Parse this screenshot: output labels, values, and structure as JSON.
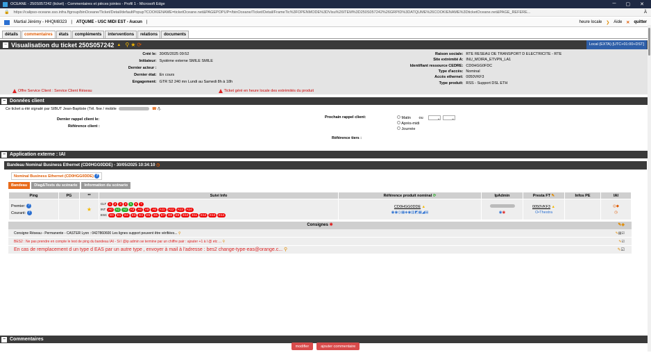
{
  "window": {
    "title": "OCEANE - 250S057242 (ticket) - Commentaires et pièces jointes - Profil 1 - Microsoft Edge",
    "minimize": "─",
    "maximize": "▢",
    "close": "✕"
  },
  "browser": {
    "url": "https://calipso-oceane.sso.infra.ftgroup/binOceane/Ticket/Detail/defaultPopup?COOKIENAME=ticketOceane.net&PAGEPOPUP=/binOceane/Ticket/Detail/FrameTic%3FOPENMODE%3DVisu%26ITEM%3D250S057242%26GRPID%3DATQUME%26COOKIENAME%3DticketOceane.net&PAGE_REFERE...",
    "a_icon": "À"
  },
  "userbar": {
    "user": "Martial Jérémy - HHQM8323",
    "sep1": "|",
    "group": "ATQUME - USC MIDI EST - Aucun",
    "sep2": "|",
    "local_time": "heure locale",
    "aide": "Aide",
    "quitter": "quitter"
  },
  "tabs": [
    "détails",
    "commentaires",
    "états",
    "compléments",
    "interventions",
    "relations",
    "documents"
  ],
  "ticket": {
    "title": "Visualisation du ticket  250S057242",
    "zone": "Local (EXTA) [UTC+01:00+DST]"
  },
  "info_left": [
    {
      "k": "Créé le:",
      "v": "30/05/2025 09:52"
    },
    {
      "k": "Initiateur:",
      "v": "Système externe SMILE SMILE"
    },
    {
      "k": "Dernier acteur :",
      "v": ""
    },
    {
      "k": "Dernier état:",
      "v": "En cours"
    },
    {
      "k": "Engagement:",
      "v": "GTR S2 240 mn Lundi au Samedi 8h à 18h"
    }
  ],
  "info_right": [
    {
      "k": "Raison sociale:",
      "v": "RTE RESEAU DE TRANSPORT D ELECTRICITE - RTE"
    },
    {
      "k": "Site extrémité A:",
      "v": "INU_MOIRA_ETVPN_LA1"
    },
    {
      "k": "Identifiant ressource CEDRE:",
      "v": "CD0HGG0FDC"
    },
    {
      "k": "Type d'accès:",
      "v": "Nominal"
    },
    {
      "k": "Accès ethernet:",
      "v": "0050VKF3"
    },
    {
      "k": "Type produit:",
      "v": "RSS - Support DSL ETH"
    }
  ],
  "warnings": {
    "left": "Offre Service Client : Service Client Réseau",
    "right": "Ticket géré en heure locale des extrémités du produit"
  },
  "donnees": {
    "title": "Données client",
    "signal": "Ce ticket a été signalé par SIBUT Jean-Baptiste (Tél. fixe / mobile",
    "signal_end": "/).",
    "dernier_rappel": "Dernier rappel client le:",
    "ref_client": "Référence client :",
    "prochain_rappel": "Prochain rappel client:",
    "opt1": "Matin",
    "ou": "ou",
    "opt2": "Après-midi",
    "opt3": "Journée",
    "ref_tiers": "Référence tiers :"
  },
  "app": {
    "title": "Application externe : IAI",
    "band": "Bandeau Nominal Business Ethernet (CD0HGG0DDE) - 30/05/2025 10:34:10",
    "nominal_tab": "Nominal Business Ethernet (CD0HGG0DDE)",
    "subtabs": [
      "Bandeau",
      "Diag&Tests du scénario",
      "Information du scénario"
    ],
    "headers": [
      "Ping",
      "PG",
      "**",
      "Suivi Info",
      "Référence produit nominal",
      "IpAdmin",
      "Presta FT",
      "Infos PE",
      "IAI"
    ],
    "ping_premier": "Premier:",
    "ping_courant": "Courant:",
    "row_labels": [
      "CLT",
      "INT",
      "ESC"
    ],
    "clt": [
      "1",
      "2",
      "3",
      "4",
      "5",
      "6",
      "7"
    ],
    "int": [
      "A0",
      "A1",
      "A2",
      "A3",
      "A4",
      "A5",
      "A6",
      "A11",
      "A12",
      "A13",
      "A14"
    ],
    "esc": [
      "E0",
      "E1",
      "E2",
      "E3",
      "E4",
      "E5",
      "E6",
      "E7",
      "E8",
      "E9",
      "E10",
      "E11",
      "E12",
      "E13",
      "E14"
    ],
    "ref_nominal": "CD0HGG0DDE",
    "presta": "0050VKF3",
    "presta2": "O•Thestra",
    "consignes_title": "Consignes",
    "consignes": [
      "Consigne Réseau - Permanente - CASTER Lyon : 0427860600 Les lignes support peuvent être vérifiées...",
      "BES2 : Ne pas prendre en compte le test de ping du bandeau IAI - Si l @ip admin se termine par un chiffre pair : ajouter +1 à l @ etc ...",
      "En cas de remplacement d un type d EAS par un autre type , envoyer à mail à l'adresse : bes2 change-type-eas@orange.c..."
    ]
  },
  "commentaires": {
    "title": "Commentaires"
  },
  "buttons": {
    "modifier": "modifier",
    "ajouter": "ajouter commentaire"
  }
}
